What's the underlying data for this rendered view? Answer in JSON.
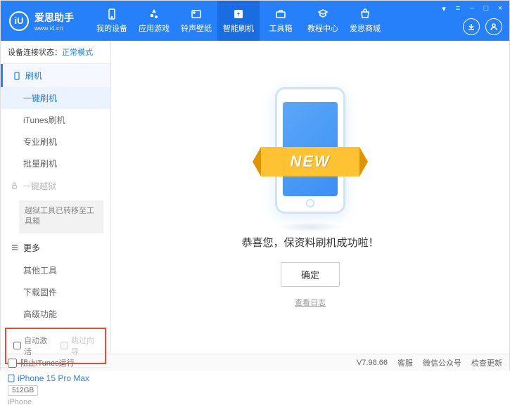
{
  "header": {
    "logo_char": "iU",
    "title": "爱思助手",
    "url": "www.i4.cn",
    "nav": [
      {
        "label": "我的设备"
      },
      {
        "label": "应用游戏"
      },
      {
        "label": "铃声壁纸"
      },
      {
        "label": "智能刷机"
      },
      {
        "label": "工具箱"
      },
      {
        "label": "教程中心"
      },
      {
        "label": "爱思商城"
      }
    ]
  },
  "status": {
    "label": "设备连接状态：",
    "mode": "正常模式"
  },
  "sidebar": {
    "flash_section": "刷机",
    "items1": [
      "一键刷机",
      "iTunes刷机",
      "专业刷机",
      "批量刷机"
    ],
    "jailbreak": "一键越狱",
    "jailbreak_note": "越狱工具已转移至工具箱",
    "more_section": "更多",
    "items2": [
      "其他工具",
      "下载固件",
      "高级功能"
    ],
    "checkboxes": {
      "auto_activate": "自动激活",
      "skip_guide": "跳过向导"
    },
    "device": {
      "name": "iPhone 15 Pro Max",
      "storage": "512GB",
      "type": "iPhone"
    }
  },
  "main": {
    "banner": "NEW",
    "message": "恭喜您，保资料刷机成功啦！",
    "confirm": "确定",
    "log_link": "查看日志"
  },
  "footer": {
    "block_itunes": "阻止iTunes运行",
    "version": "V7.98.66",
    "links": [
      "客服",
      "微信公众号",
      "检查更新"
    ]
  }
}
